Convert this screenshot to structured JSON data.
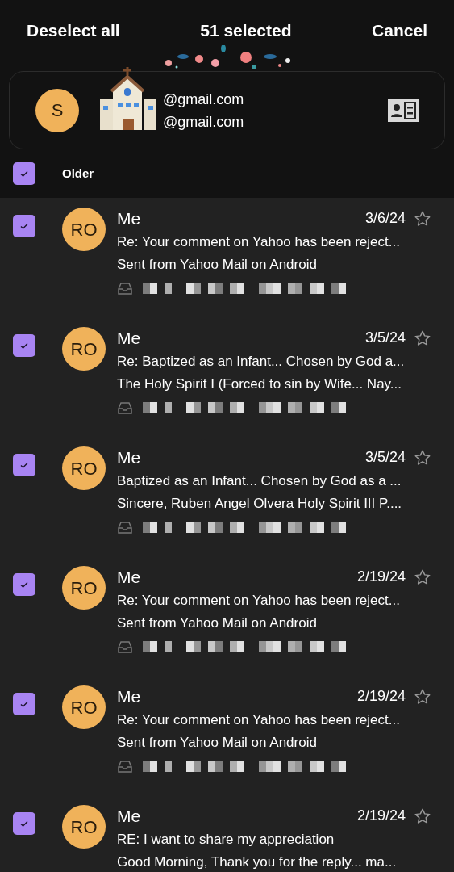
{
  "header": {
    "left_action": "Deselect all",
    "title": "51 selected",
    "right_action": "Cancel"
  },
  "account": {
    "initial": "S",
    "emails": [
      "@gmail.com",
      "@gmail.com"
    ]
  },
  "section": {
    "label": "Older",
    "checked": true
  },
  "messages": [
    {
      "initials": "RO",
      "sender": "Me",
      "date": "3/6/24",
      "starred": false,
      "checked": true,
      "subject": "Re: Your comment on Yahoo has been reject...",
      "preview": "Sent from Yahoo Mail on Android",
      "folder_visible": true
    },
    {
      "initials": "RO",
      "sender": "Me",
      "date": "3/5/24",
      "starred": false,
      "checked": true,
      "subject": "Re: Baptized as an Infant... Chosen by God a...",
      "preview": "The Holy Spirit I (Forced to sin by Wife... Nay...",
      "folder_visible": true
    },
    {
      "initials": "RO",
      "sender": "Me",
      "date": "3/5/24",
      "starred": false,
      "checked": true,
      "subject": "Baptized as an Infant... Chosen by God as a ...",
      "preview": "Sincere, Ruben Angel Olvera Holy Spirit III P....",
      "folder_visible": true
    },
    {
      "initials": "RO",
      "sender": "Me",
      "date": "2/19/24",
      "starred": false,
      "checked": true,
      "subject": "Re: Your comment on Yahoo has been reject...",
      "preview": "Sent from Yahoo Mail on Android",
      "folder_visible": true
    },
    {
      "initials": "RO",
      "sender": "Me",
      "date": "2/19/24",
      "starred": false,
      "checked": true,
      "subject": "Re: Your comment on Yahoo has been reject...",
      "preview": "Sent from Yahoo Mail on Android",
      "folder_visible": true
    },
    {
      "initials": "RO",
      "sender": "Me",
      "date": "2/19/24",
      "starred": false,
      "checked": true,
      "subject": "RE: I want to share my appreciation",
      "preview": "Good Morning, Thank you for the reply... ma...",
      "folder_visible": false
    }
  ]
}
